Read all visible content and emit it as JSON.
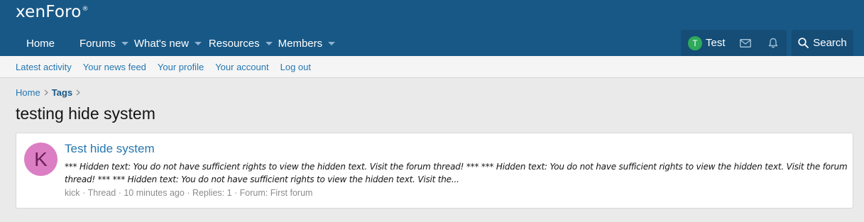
{
  "brand": {
    "logo_text": "xenForo",
    "logo_mark": "®"
  },
  "nav": {
    "items": [
      {
        "label": "Home"
      },
      {
        "label": "Forums"
      },
      {
        "label": "What's new"
      },
      {
        "label": "Resources"
      },
      {
        "label": "Members"
      }
    ],
    "user": {
      "initial": "T",
      "name": "Test"
    },
    "search_label": "Search"
  },
  "subnav": {
    "links": [
      "Latest activity",
      "Your news feed",
      "Your profile",
      "Your account",
      "Log out"
    ]
  },
  "breadcrumb": {
    "home": "Home",
    "current": "Tags"
  },
  "page_title": "testing hide system",
  "result": {
    "avatar_initial": "K",
    "title": "Test hide system",
    "snippet": "*** Hidden text: You do not have sufficient rights to view the hidden text. Visit the forum thread! *** *** Hidden text: You do not have sufficient rights to view the hidden text. Visit the forum thread! *** *** Hidden text: You do not have sufficient rights to view the hidden text. Visit the...",
    "meta": {
      "author": "kick",
      "type": "Thread",
      "time": "10 minutes ago",
      "replies": "Replies: 1",
      "forum": "Forum: First forum",
      "separator": " · "
    }
  },
  "colors": {
    "header_bg": "#185886",
    "link": "#2577b1",
    "user_avatar": "#2eaa5a",
    "result_avatar": "#dc7ec3"
  }
}
